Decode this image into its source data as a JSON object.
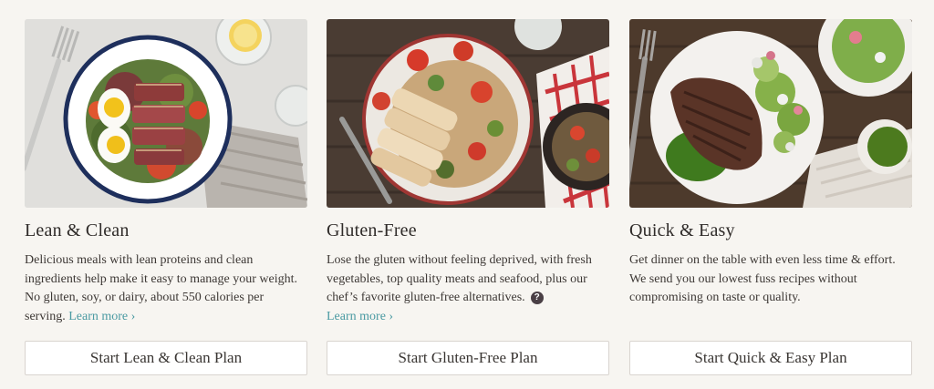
{
  "plans": [
    {
      "title": "Lean & Clean",
      "description": "Delicious meals with lean proteins and clean ingredients help make it easy to manage your weight. No gluten, soy, or dairy, about 550 calories per serving.",
      "learn_more": "Learn more ›",
      "button": "Start Lean & Clean Plan",
      "photo_icon": "seared-tuna-salad-photo"
    },
    {
      "title": "Gluten-Free",
      "description": "Lose the gluten without feeling deprived, with fresh vegetables, top quality meats and seafood, plus our chef’s favorite gluten-free alternatives.",
      "help_icon": "?",
      "learn_more": "Learn more ›",
      "button": "Start Gluten-Free Plan",
      "photo_icon": "chicken-orzo-photo"
    },
    {
      "title": "Quick & Easy",
      "description": "Get dinner on the table with even less time & effort. We send you our lowest fuss recipes without compromising on taste or quality.",
      "button": "Start Quick & Easy Plan",
      "photo_icon": "steak-salad-photo"
    }
  ],
  "colors": {
    "background": "#f7f5f1",
    "link": "#4a9aa2",
    "text": "#3a3633",
    "button_border": "#d9d4cf"
  }
}
